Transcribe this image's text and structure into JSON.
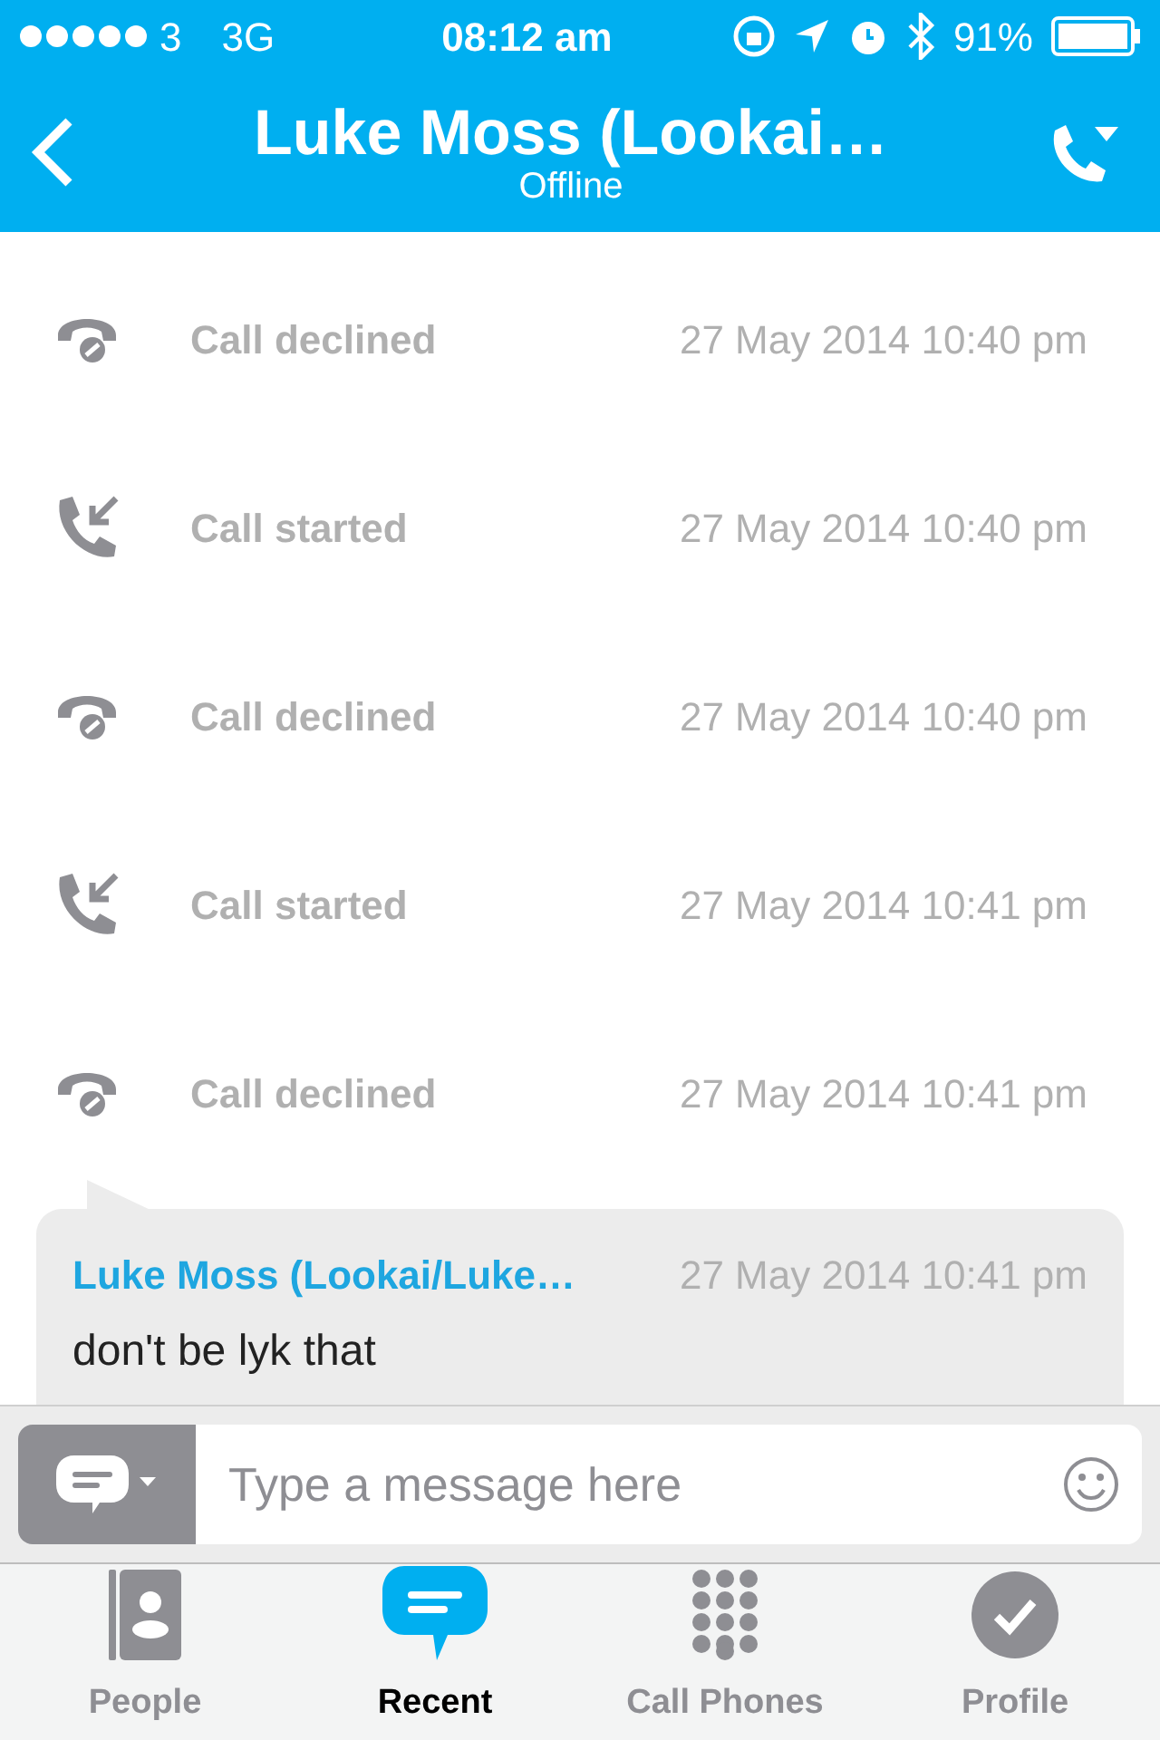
{
  "status_bar": {
    "carrier": "3",
    "network": "3G",
    "time": "08:12 am",
    "battery": "91%"
  },
  "header": {
    "title": "Luke Moss (Lookai…",
    "subtitle": "Offline"
  },
  "events": [
    {
      "kind": "declined",
      "label": "Call declined",
      "time": "27 May 2014 10:40 pm"
    },
    {
      "kind": "started",
      "label": "Call started",
      "time": "27 May 2014 10:40 pm"
    },
    {
      "kind": "declined",
      "label": "Call declined",
      "time": "27 May 2014 10:40 pm"
    },
    {
      "kind": "started",
      "label": "Call started",
      "time": "27 May 2014 10:41 pm"
    },
    {
      "kind": "declined",
      "label": "Call declined",
      "time": "27 May 2014 10:41 pm"
    }
  ],
  "message": {
    "sender": "Luke Moss (Lookai/Luke…",
    "time": "27 May 2014 10:41 pm",
    "text": "don't be lyk that"
  },
  "composer": {
    "placeholder": "Type a message here"
  },
  "tabs": [
    {
      "kind": "people",
      "label": "People",
      "selected": false
    },
    {
      "kind": "recent",
      "label": "Recent",
      "selected": true
    },
    {
      "kind": "dialpad",
      "label": "Call Phones",
      "selected": false
    },
    {
      "kind": "profile",
      "label": "Profile",
      "selected": false
    }
  ]
}
